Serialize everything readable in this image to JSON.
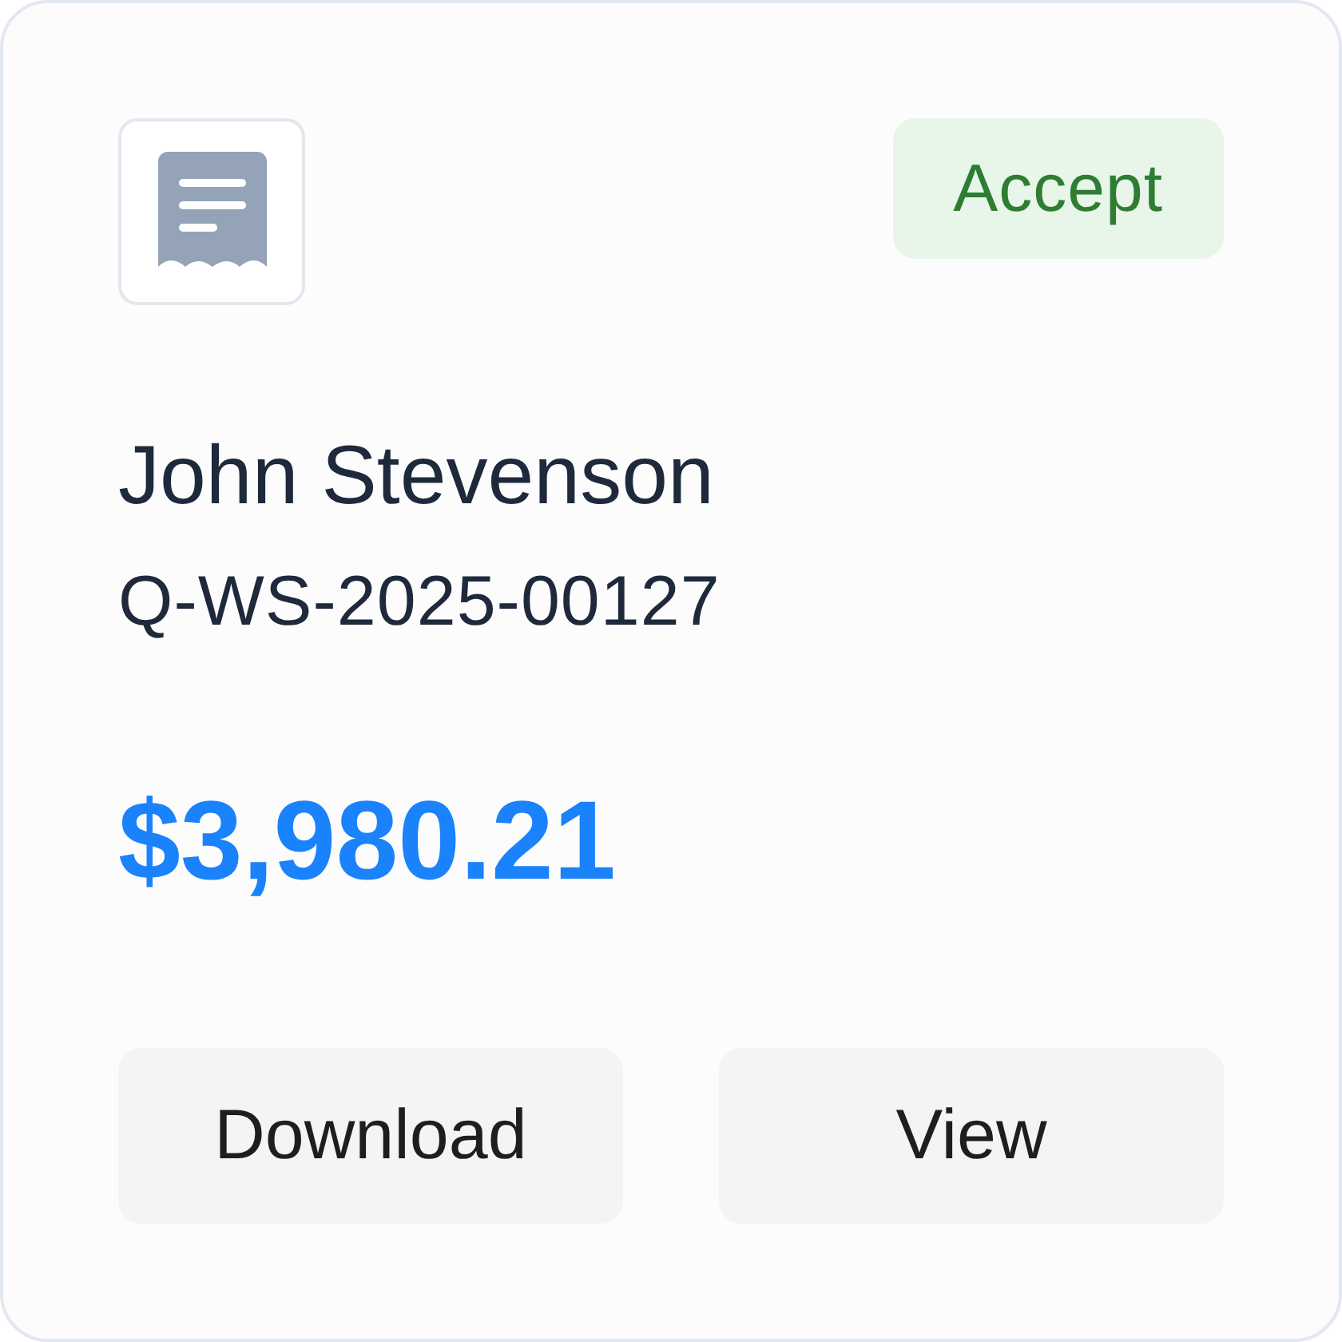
{
  "card": {
    "status": {
      "label": "Accept",
      "kind": "accept"
    },
    "customer": "John Stevenson",
    "quote_number": "Q-WS-2025-00127",
    "amount": "$3,980.21",
    "buttons": [
      "Download",
      "View"
    ]
  }
}
